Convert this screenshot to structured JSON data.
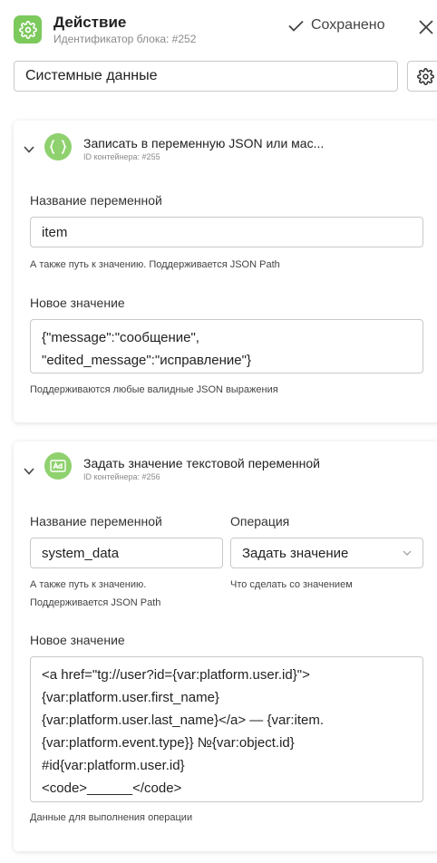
{
  "header": {
    "title": "Действие",
    "block_id": "Идентификатор блока: #252",
    "saved_label": "Сохранено",
    "icon": "gear-icon",
    "accent": "#7cc95c"
  },
  "name_field": {
    "value": "Системные данные"
  },
  "blocks": [
    {
      "title": "Записать в переменную JSON или мас...",
      "container_id": "ID контейнера: #255",
      "icon": "braces-icon",
      "variable_label": "Название переменной",
      "variable_value": "item",
      "variable_hint": "А также путь к значению. Поддерживается JSON Path",
      "value_label": "Новое значение",
      "value_lines": [
        "{\"message\":\"сообщение\",",
        "\"edited_message\":\"исправление\"}"
      ],
      "value_hint": "Поддерживаются любые валидные JSON выражения"
    },
    {
      "title": "Задать значение текстовой переменной",
      "container_id": "ID контейнера: #256",
      "icon": "text-variable-icon",
      "variable_label": "Название переменной",
      "variable_value": "system_data",
      "variable_hint_lines": [
        "А также путь к значению.",
        "Поддерживается JSON Path"
      ],
      "operation_label": "Операция",
      "operation_value": "Задать значение",
      "operation_hint": "Что сделать со значением",
      "value_label": "Новое значение",
      "value_lines": [
        "<a href=\"tg://user?id={var:platform.user.id}\">",
        "{var:platform.user.first_name}",
        "{var:platform.user.last_name}</a> — {var:item.",
        "{var:platform.event.type}} №{var:object.id}",
        "#id{var:platform.user.id}",
        "<code>______</code>"
      ],
      "value_hint": "Данные для выполнения операции"
    }
  ]
}
